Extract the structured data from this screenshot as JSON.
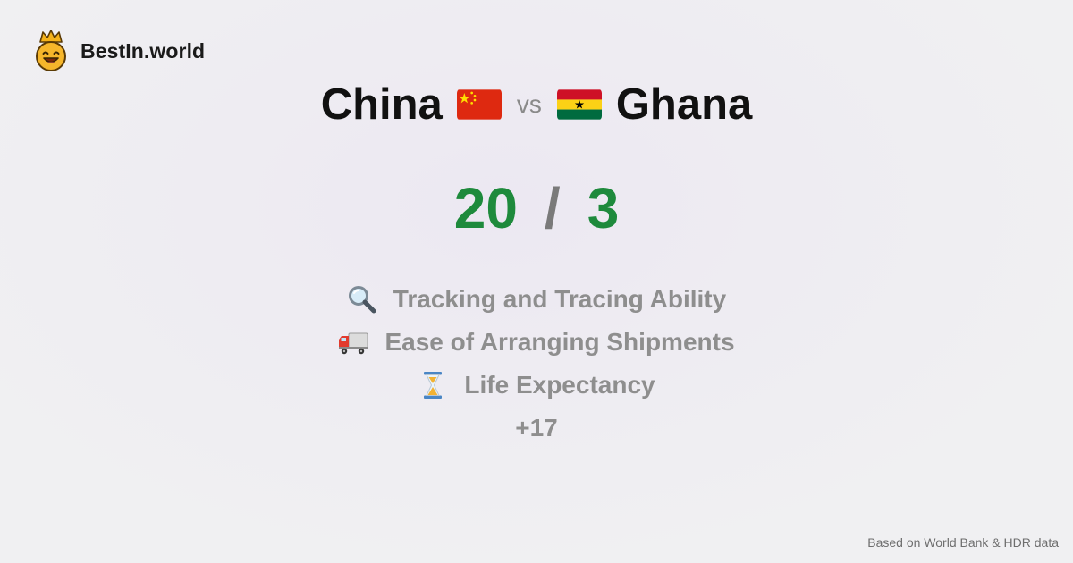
{
  "brand": {
    "name": "BestIn.world",
    "logo_icon": "crowned-smiley-logo-icon"
  },
  "comparison": {
    "left": {
      "name": "China",
      "flag_icon": "china-flag-icon"
    },
    "vs_label": "vs",
    "right": {
      "name": "Ghana",
      "flag_icon": "ghana-flag-icon"
    }
  },
  "score": {
    "left": "20",
    "separator": "/",
    "right": "3"
  },
  "metrics": [
    {
      "icon": "magnifying-glass-icon",
      "label": "Tracking and Tracing Ability"
    },
    {
      "icon": "delivery-truck-icon",
      "label": "Ease of Arranging Shipments"
    },
    {
      "icon": "hourglass-icon",
      "label": "Life Expectancy"
    }
  ],
  "more_label": "+17",
  "footer": {
    "source_text": "Based on World Bank & HDR data"
  },
  "colors": {
    "score_green": "#1e8a3c",
    "muted_text": "#8e8e8e",
    "china_red": "#de2910",
    "china_yellow": "#ffde00",
    "ghana_red": "#ce1126",
    "ghana_gold": "#fcd116",
    "ghana_green": "#006b3f"
  }
}
